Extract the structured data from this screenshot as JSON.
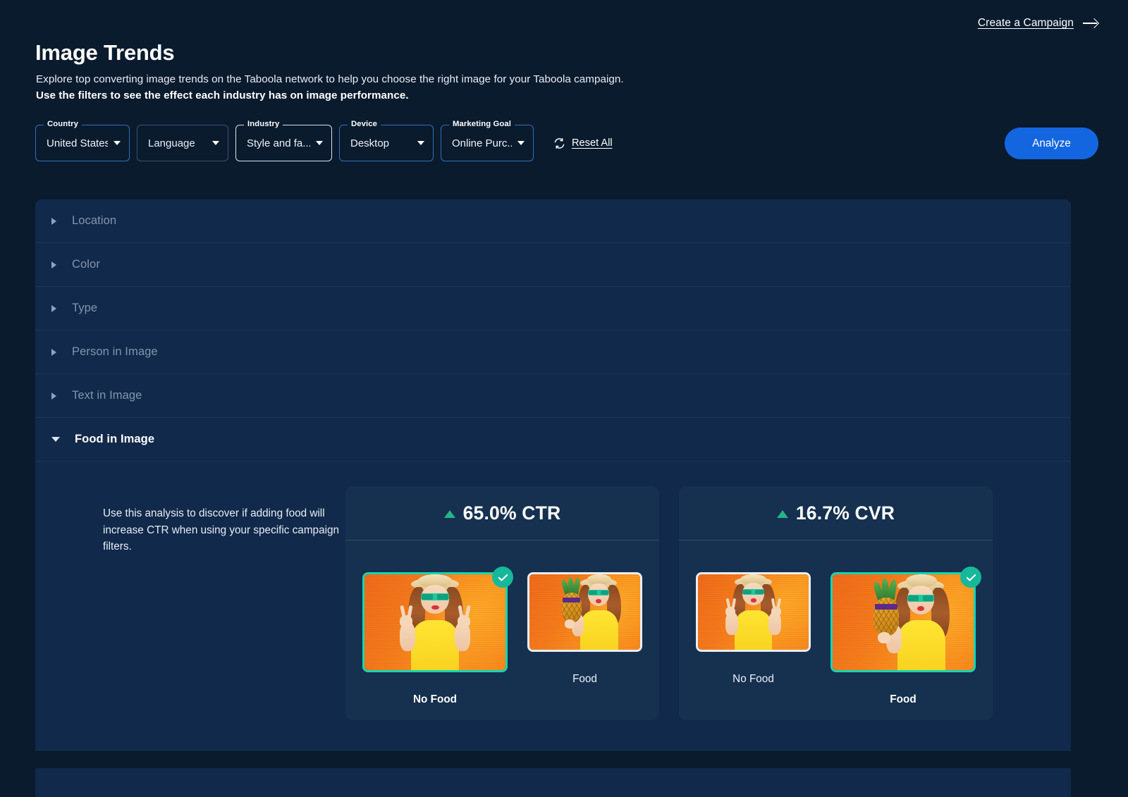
{
  "header": {
    "create_campaign_label": "Create a Campaign",
    "title": "Image Trends",
    "subtitle_line1": "Explore top converting image trends on the Taboola network to help you choose the right image for your Taboola campaign.",
    "subtitle_line2": "Use the filters to see the effect each industry has on image performance."
  },
  "filters": {
    "country": {
      "label": "Country",
      "value": "United States"
    },
    "language": {
      "label": "",
      "value": "Language"
    },
    "industry": {
      "label": "Industry",
      "value": "Style and fa..."
    },
    "device": {
      "label": "Device",
      "value": "Desktop"
    },
    "goal": {
      "label": "Marketing Goal",
      "value": "Online Purc..."
    },
    "reset_label": "Reset All",
    "analyze_label": "Analyze"
  },
  "accordion": {
    "items": [
      {
        "label": "Location",
        "open": false
      },
      {
        "label": "Color",
        "open": false
      },
      {
        "label": "Type",
        "open": false
      },
      {
        "label": "Person in Image",
        "open": false
      },
      {
        "label": "Text in Image",
        "open": false
      },
      {
        "label": "Food in Image",
        "open": true
      }
    ],
    "expanded": {
      "description": "Use this analysis to discover if adding food will increase CTR when using your specific campaign filters.",
      "cards": [
        {
          "metric": "65.0% CTR",
          "direction": "up",
          "options": [
            {
              "label": "No Food",
              "winner": true,
              "image": "woman-peace-signs-orange"
            },
            {
              "label": "Food",
              "winner": false,
              "image": "woman-pineapple-orange"
            }
          ]
        },
        {
          "metric": "16.7% CVR",
          "direction": "up",
          "options": [
            {
              "label": "No Food",
              "winner": false,
              "image": "woman-peace-signs-orange"
            },
            {
              "label": "Food",
              "winner": true,
              "image": "woman-pineapple-orange"
            }
          ]
        }
      ]
    }
  },
  "colors": {
    "background": "#0a1b2e",
    "panel": "#11294a",
    "card": "#16304f",
    "accent_blue": "#1466e0",
    "winner_green": "#17d6b2",
    "badge_green": "#17b79a",
    "metric_arrow_green": "#27b387"
  }
}
